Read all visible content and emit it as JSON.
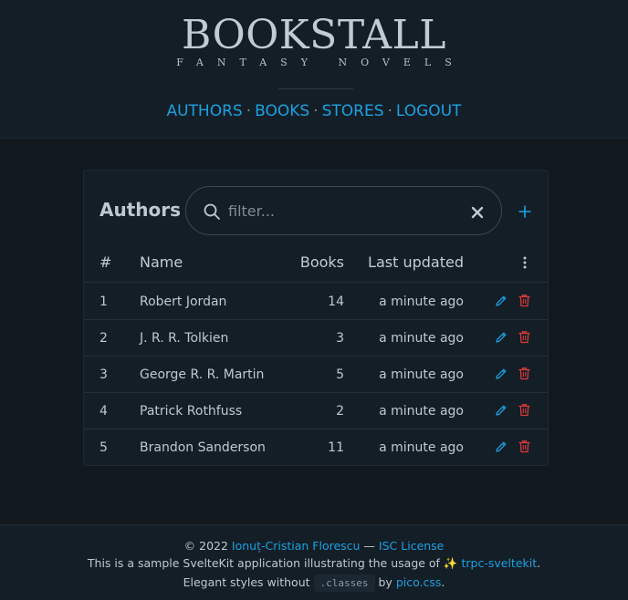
{
  "header": {
    "brand": "BOOKSTALL",
    "tagline": "FANTASY NOVELS",
    "nav": [
      {
        "label": "AUTHORS"
      },
      {
        "label": "BOOKS"
      },
      {
        "label": "STORES"
      },
      {
        "label": "LOGOUT"
      }
    ],
    "separator": "·"
  },
  "card": {
    "title": "Authors",
    "search": {
      "placeholder": "filter...",
      "value": ""
    },
    "columns": {
      "num": "#",
      "name": "Name",
      "books": "Books",
      "updated": "Last updated"
    },
    "rows": [
      {
        "num": "1",
        "name": "Robert Jordan",
        "books": "14",
        "updated": "a minute ago"
      },
      {
        "num": "2",
        "name": "J. R. R. Tolkien",
        "books": "3",
        "updated": "a minute ago"
      },
      {
        "num": "3",
        "name": "George R. R. Martin",
        "books": "5",
        "updated": "a minute ago"
      },
      {
        "num": "4",
        "name": "Patrick Rothfuss",
        "books": "2",
        "updated": "a minute ago"
      },
      {
        "num": "5",
        "name": "Brandon Sanderson",
        "books": "11",
        "updated": "a minute ago"
      }
    ]
  },
  "icons": {
    "search": "search-icon",
    "clear": "close-icon",
    "add": "plus-icon",
    "menu": "kebab-menu-icon",
    "edit": "pencil-icon",
    "delete": "trash-icon"
  },
  "footer": {
    "copyright_prefix": "© 2022 ",
    "author_link": "Ionuț-Cristian Florescu",
    "dash": " — ",
    "license_link": "ISC License",
    "line2_prefix": "This is a sample SvelteKit application illustrating the usage of ✨ ",
    "trpc_link": "trpc-sveltekit",
    "line2_suffix": ".",
    "line3_prefix": "Elegant styles without",
    "code": ".classes",
    "line3_by": "by ",
    "pico_link": "pico.css",
    "line3_suffix": "."
  },
  "colors": {
    "accent": "#1aa1e3",
    "danger": "#d93a3a",
    "background": "#11191f",
    "surface": "#141e26"
  }
}
